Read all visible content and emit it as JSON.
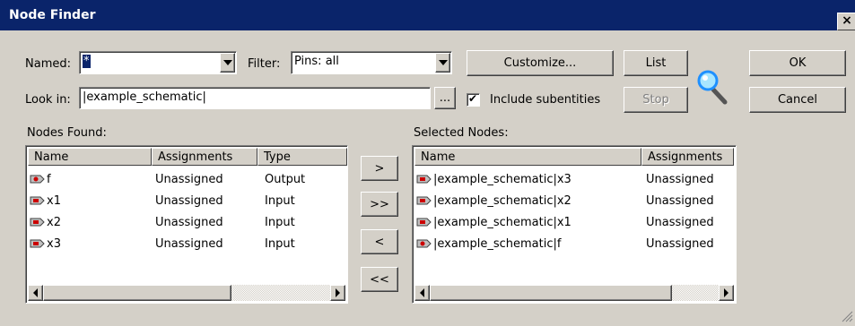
{
  "window": {
    "title": "Node Finder",
    "close_label": "×"
  },
  "named": {
    "label": "Named:",
    "value": "*"
  },
  "filter": {
    "label": "Filter:",
    "value": "Pins: all"
  },
  "look_in": {
    "label": "Look in:",
    "value": "|example_schematic|",
    "browse_label": "..."
  },
  "include_subentities": {
    "label": "Include subentities",
    "checked": true,
    "check_glyph": "✔"
  },
  "buttons": {
    "customize": "Customize...",
    "list": "List",
    "stop": "Stop",
    "ok": "OK",
    "cancel": "Cancel",
    "add": ">",
    "add_all": ">>",
    "remove": "<",
    "remove_all": "<<"
  },
  "nodes_found": {
    "label": "Nodes Found:",
    "columns": [
      "Name",
      "Assignments",
      "Type"
    ],
    "rows": [
      {
        "name": "f",
        "assignment": "Unassigned",
        "type": "Output",
        "pin": "output"
      },
      {
        "name": "x1",
        "assignment": "Unassigned",
        "type": "Input",
        "pin": "input"
      },
      {
        "name": "x2",
        "assignment": "Unassigned",
        "type": "Input",
        "pin": "input"
      },
      {
        "name": "x3",
        "assignment": "Unassigned",
        "type": "Input",
        "pin": "input"
      }
    ]
  },
  "selected_nodes": {
    "label": "Selected Nodes:",
    "columns": [
      "Name",
      "Assignments"
    ],
    "rows": [
      {
        "name": "|example_schematic|x3",
        "assignment": "Unassigned",
        "pin": "input"
      },
      {
        "name": "|example_schematic|x2",
        "assignment": "Unassigned",
        "pin": "input"
      },
      {
        "name": "|example_schematic|x1",
        "assignment": "Unassigned",
        "pin": "input"
      },
      {
        "name": "|example_schematic|f",
        "assignment": "Unassigned",
        "pin": "output"
      }
    ]
  },
  "colors": {
    "titlebar": "#0a246a",
    "face": "#d4d0c8",
    "pin_red": "#cc0000",
    "magnifier": "#1e90ff"
  },
  "icons": {
    "magnifier": "magnifier-icon",
    "input_pin": "input-pin-icon",
    "output_pin": "output-pin-icon"
  }
}
